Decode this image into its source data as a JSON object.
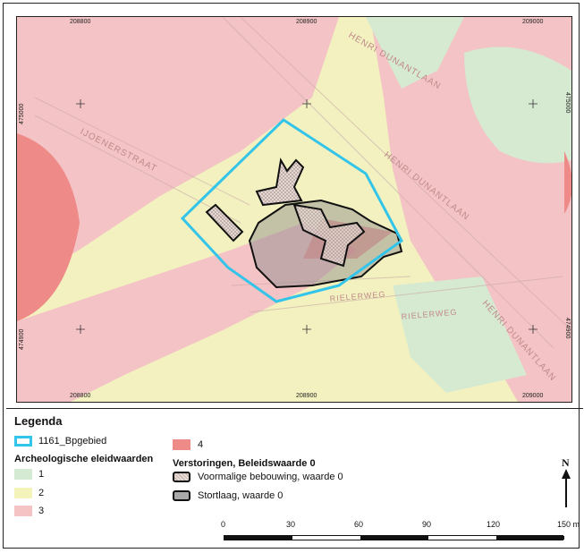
{
  "map": {
    "top_ticks": [
      "208800",
      "208900",
      "209000"
    ],
    "bottom_ticks": [
      "208800",
      "208900",
      "209000"
    ],
    "left_ticks": [
      "475000",
      "474900"
    ],
    "right_ticks": [
      "475000",
      "474900"
    ],
    "street_labels": {
      "dunant_top": "HENRI DUNANTLAAN",
      "dunant_mid": "HENRI DUNANTLAAN",
      "dunant_bottom": "HENRI DUNANTLAAN",
      "ijsselstraat": "IJOENERSTRAAT",
      "rielerweg_1": "RIELERWEG",
      "rielerweg_2": "RIELERWEG"
    }
  },
  "legend": {
    "title": "Legenda",
    "plan_area": {
      "label": "1161_Bpgebied",
      "color": "#33c4ea"
    },
    "arch_header": "Archeologische eleidwaarden",
    "arch_values": [
      {
        "label": "1",
        "color": "#d5ead3"
      },
      {
        "label": "2",
        "color": "#f3f3ba"
      },
      {
        "label": "3",
        "color": "#f6c3c5"
      },
      {
        "label": "4",
        "color": "#ee8a88"
      }
    ],
    "dist_header": "Verstoringen, Beleidswaarde 0",
    "disturbances": [
      {
        "label": "Voormalige bebouwing, waarde 0"
      },
      {
        "label": "Stortlaag, waarde 0"
      }
    ]
  },
  "scalebar": {
    "labels": [
      "0",
      "30",
      "60",
      "90",
      "120",
      "150 m"
    ]
  },
  "north_arrow": {
    "label": "N"
  }
}
